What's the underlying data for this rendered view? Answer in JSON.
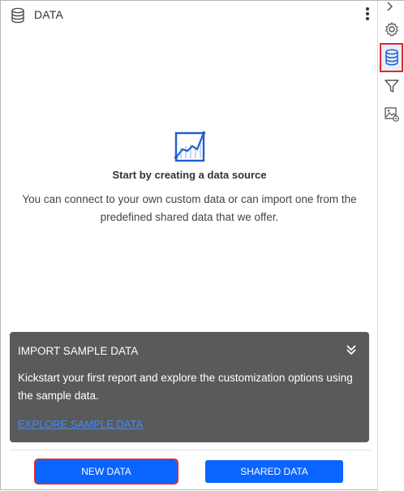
{
  "panel": {
    "title": "DATA",
    "header_icon": "database-icon",
    "menu_icon": "more-vertical-icon"
  },
  "empty_state": {
    "icon": "line-chart-icon",
    "title": "Start by creating a data source",
    "description": "You can connect to your own custom data or can import one from the predefined shared data that we offer."
  },
  "sample": {
    "title": "IMPORT SAMPLE DATA",
    "collapse_icon": "double-chevron-down-icon",
    "description": "Kickstart your first report and explore the customization options using the sample data.",
    "link": "EXPLORE SAMPLE DATA"
  },
  "buttons": {
    "new_data": "NEW DATA",
    "shared_data": "SHARED DATA"
  },
  "toolbar": {
    "items": [
      {
        "icon": "chevron-right-icon"
      },
      {
        "icon": "gear-icon"
      },
      {
        "icon": "database-icon",
        "active": true
      },
      {
        "icon": "filter-icon"
      },
      {
        "icon": "image-settings-icon"
      }
    ]
  },
  "colors": {
    "accent": "#0a64ff",
    "highlight": "#e0282e",
    "sample_bg": "#5a5a5a",
    "link": "#3d8bff"
  }
}
